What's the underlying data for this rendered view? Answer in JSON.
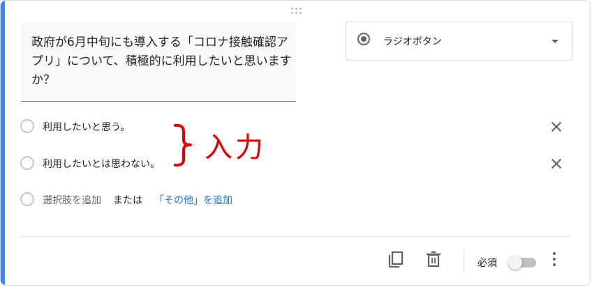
{
  "question": {
    "text": "政府が6月中旬にも導入する「コロナ接触確認アプリ」について、積極的に利用したいと思いますか？"
  },
  "question_type": {
    "selected": "ラジオボタン",
    "icon": "radio-button-icon"
  },
  "options": [
    {
      "label": "利用したいと思う。"
    },
    {
      "label": "利用したいとは思わない。"
    }
  ],
  "add_option": {
    "label": "選択肢を追加",
    "or_label": "または",
    "other_label": "「その他」を追加"
  },
  "annotation": {
    "text": "入力",
    "color": "#e00000"
  },
  "footer": {
    "required_label": "必須",
    "required_on": false,
    "icons": [
      "copy-icon",
      "trash-icon",
      "more-vert-icon"
    ]
  },
  "colors": {
    "accent": "#4285f4",
    "link": "#1a73e8"
  }
}
